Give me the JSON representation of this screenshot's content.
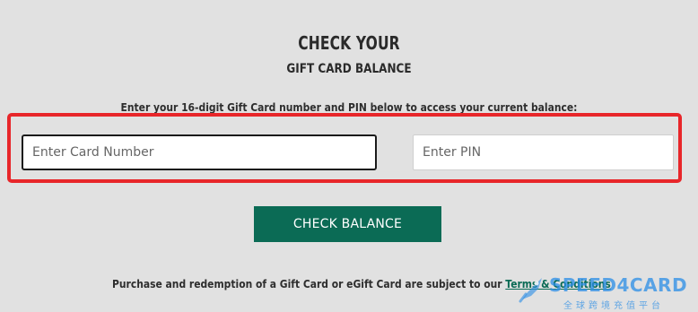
{
  "header": {
    "title": "CHECK YOUR",
    "subtitle": "GIFT CARD BALANCE"
  },
  "form": {
    "instructions": "Enter your 16-digit Gift Card number and PIN below to access your current balance:",
    "card_number": {
      "placeholder": "Enter Card Number",
      "value": ""
    },
    "pin": {
      "placeholder": "Enter PIN",
      "value": ""
    },
    "submit_label": "CHECK BALANCE"
  },
  "footer": {
    "text": "Purchase and redemption of a Gift Card or eGift Card are subject to our ",
    "link_label": "Terms & Conditions"
  },
  "watermark": {
    "brand": "SPEED4CARD",
    "tagline": "全球跨境充值平台"
  },
  "colors": {
    "background": "#e1e1e1",
    "button": "#0b6b55",
    "highlight": "#e8262a",
    "watermark": "#288ce6"
  },
  "icons": {
    "watermark_logo": "rocket-icon"
  }
}
